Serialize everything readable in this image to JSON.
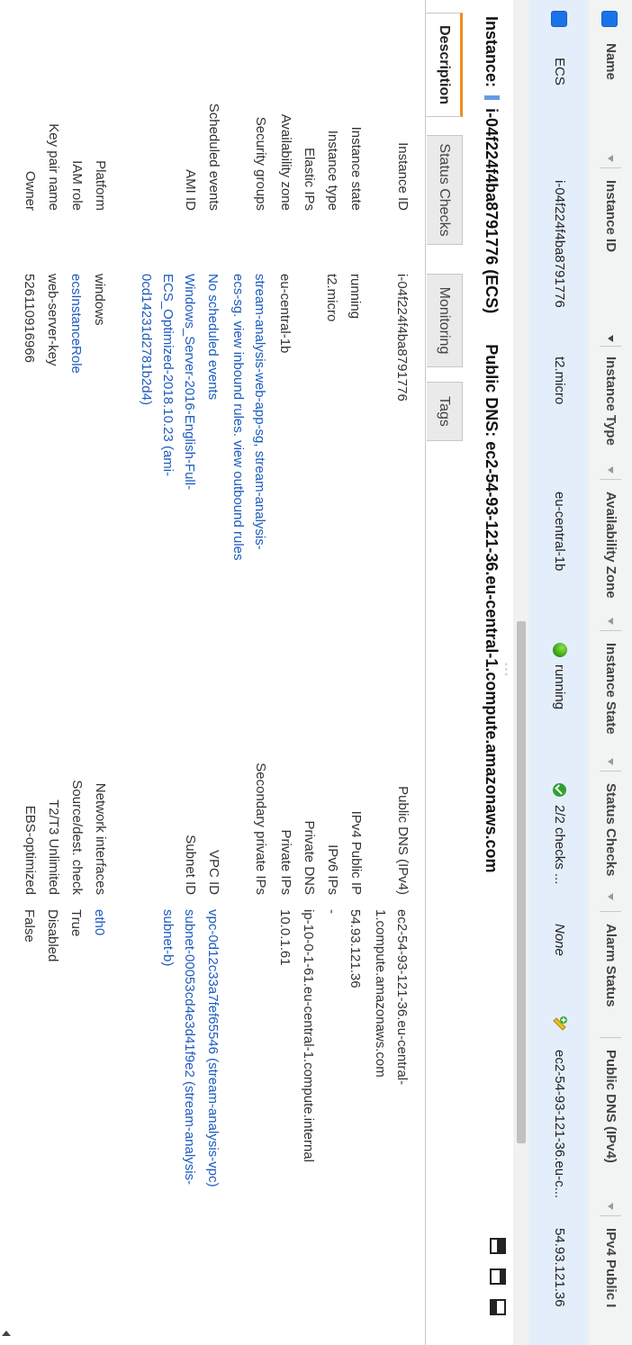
{
  "table": {
    "headers": [
      "Name",
      "Instance ID",
      "Instance Type",
      "Availability Zone",
      "Instance State",
      "Status Checks",
      "Alarm Status",
      "Public DNS (IPv4)",
      "IPv4 Public I"
    ],
    "row": {
      "name": "ECS",
      "instance_id": "i-04f224f4ba8791776",
      "instance_type": "t2.micro",
      "availability_zone": "eu-central-1b",
      "instance_state": "running",
      "status_checks": "2/2 checks ...",
      "alarm_status": "None",
      "public_dns": "ec2-54-93-121-36.eu-c...",
      "ipv4_public": "54.93.121.36"
    }
  },
  "details": {
    "instance_label": "Instance:",
    "instance_value": "i-04f224f4ba8791776 (ECS)",
    "public_dns_label": "Public DNS:",
    "public_dns_value": "ec2-54-93-121-36.eu-central-1.compute.amazonaws.com",
    "tabs": [
      "Description",
      "Status Checks",
      "Monitoring",
      "Tags"
    ],
    "left_fields": [
      {
        "label": "Instance ID",
        "value": "i-04f224f4ba8791776"
      },
      {
        "label": "Instance state",
        "value": "running"
      },
      {
        "label": "Instance type",
        "value": "t2.micro"
      },
      {
        "label": "Elastic IPs",
        "value": ""
      },
      {
        "label": "Availability zone",
        "value": "eu-central-1b"
      },
      {
        "label": "Security groups",
        "value_links": [
          "stream-analysis-web-app-sg, stream-analysis-",
          "ecs-sg. view inbound rules. view outbound rules"
        ]
      },
      {
        "label": "Scheduled events",
        "value": "No scheduled events"
      },
      {
        "label": "AMI ID",
        "value_links": [
          "Windows_Server-2016-English-Full-",
          "ECS_Optimized-2018.10.23 (ami-",
          "0cd14231d2781b2d4)"
        ]
      },
      {
        "label": "Platform",
        "value": "windows"
      },
      {
        "label": "IAM role",
        "value": "ecsInstanceRole"
      },
      {
        "label": "Key pair name",
        "value": "web-server-key"
      },
      {
        "label": "Owner",
        "value": "526110916966"
      }
    ],
    "right_fields": [
      {
        "label": "Public DNS (IPv4)",
        "value_lines": [
          "ec2-54-93-121-36.eu-central-",
          "1.compute.amazonaws.com"
        ]
      },
      {
        "label": "IPv4 Public IP",
        "value": "54.93.121.36"
      },
      {
        "label": "IPv6 IPs",
        "value": "-"
      },
      {
        "label": "Private DNS",
        "value": "ip-10-0-1-61.eu-central-1.compute.internal"
      },
      {
        "label": "Private IPs",
        "value": "10.0.1.61"
      },
      {
        "label": "Secondary private IPs",
        "value": ""
      },
      {
        "label": "VPC ID",
        "value": "vpc-0d12c33a7fef65546 (stream-analysis-vpc)"
      },
      {
        "label": "Subnet ID",
        "value_lines": [
          "subnet-00053cd4e3d41f9e2 (stream-analysis-",
          "subnet-b)"
        ]
      },
      {
        "label": "Network interfaces",
        "value": "eth0"
      },
      {
        "label": "Source/dest. check",
        "value": "True"
      },
      {
        "label": "T2/T3 Unlimited",
        "value": "Disabled"
      },
      {
        "label": "EBS-optimized",
        "value": "False"
      }
    ]
  },
  "colors": {
    "selected_row": "#e4eefb",
    "link": "#1d5bbf",
    "active_tab": "#ec8f1d"
  }
}
